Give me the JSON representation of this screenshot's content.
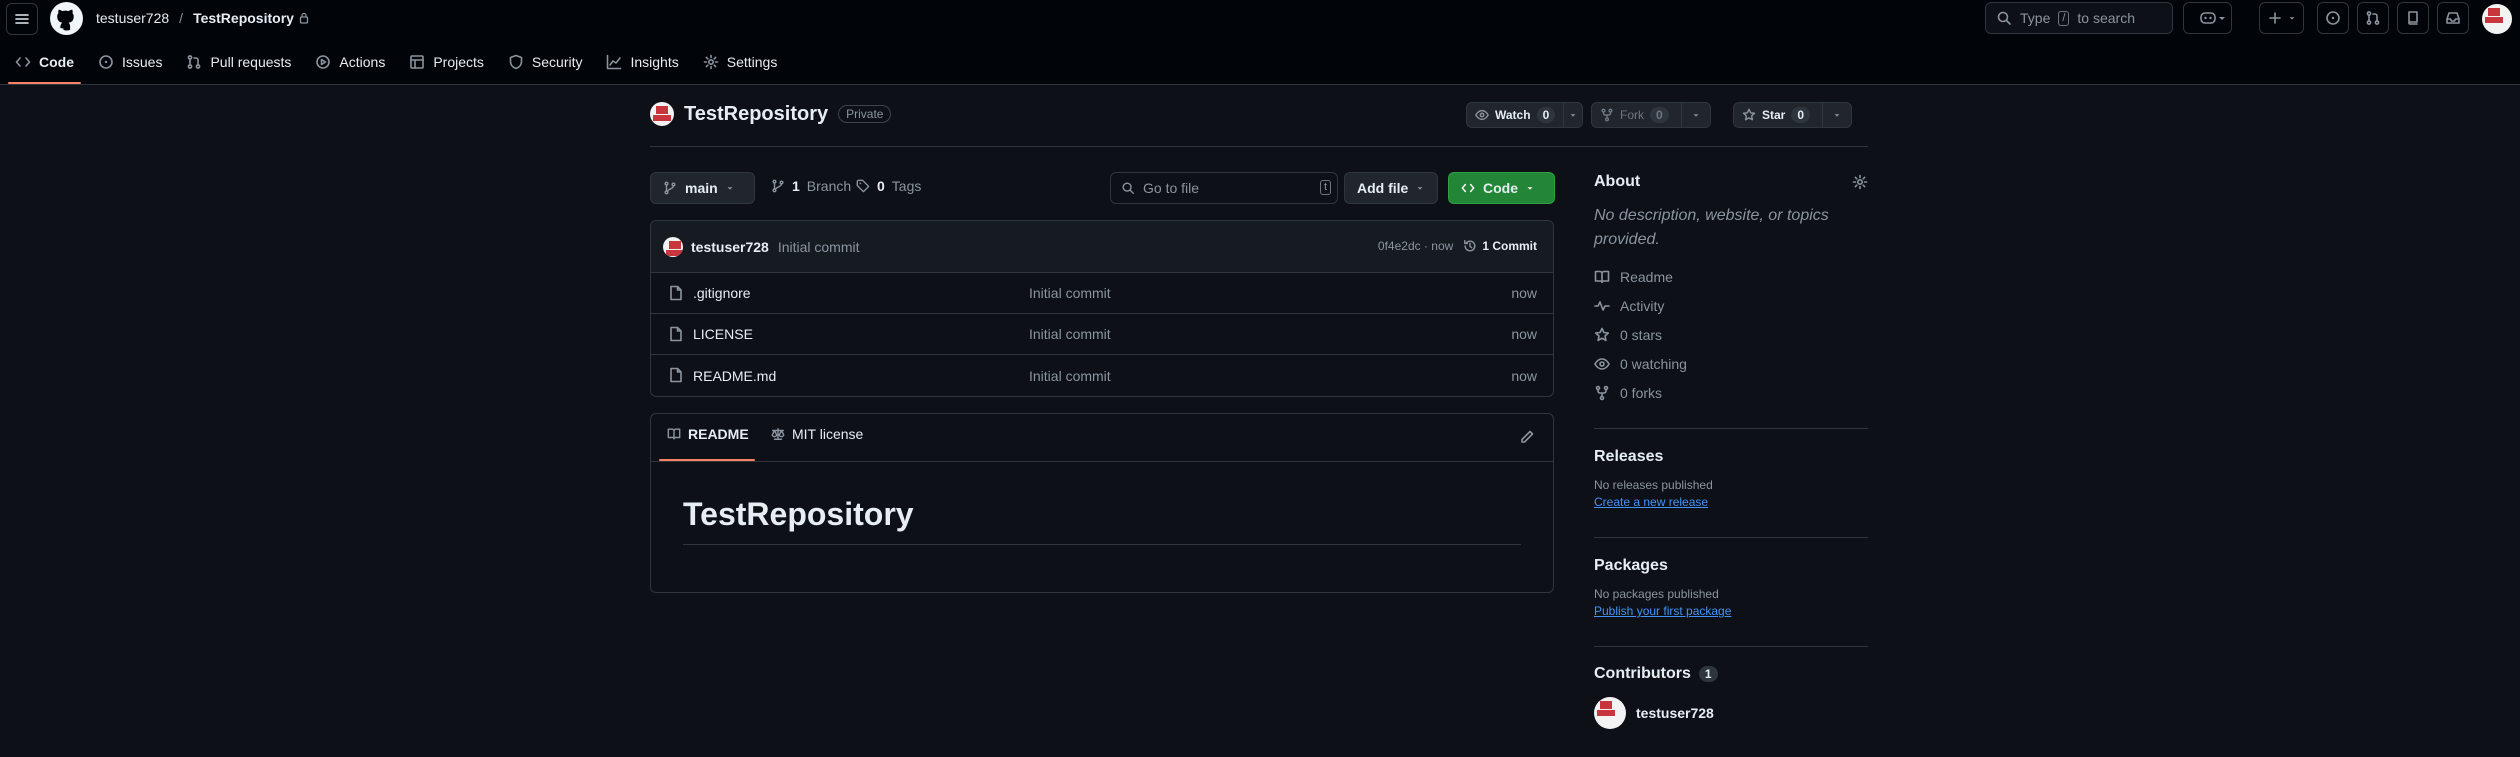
{
  "header": {
    "owner": "testuser728",
    "separator": "/",
    "repo": "TestRepository",
    "search_placeholder_1": "Type",
    "search_key": "/",
    "search_placeholder_2": "to search"
  },
  "tabs": [
    {
      "label": "Code",
      "icon": "code-icon"
    },
    {
      "label": "Issues",
      "icon": "issue-icon"
    },
    {
      "label": "Pull requests",
      "icon": "pull-request-icon"
    },
    {
      "label": "Actions",
      "icon": "play-icon"
    },
    {
      "label": "Projects",
      "icon": "table-icon"
    },
    {
      "label": "Security",
      "icon": "shield-icon"
    },
    {
      "label": "Insights",
      "icon": "graph-icon"
    },
    {
      "label": "Settings",
      "icon": "gear-icon"
    }
  ],
  "repo": {
    "name": "TestRepository",
    "visibility": "Private",
    "watch_label": "Watch",
    "watch_count": "0",
    "fork_label": "Fork",
    "fork_count": "0",
    "star_label": "Star",
    "star_count": "0"
  },
  "toolbar": {
    "branch": "main",
    "branch_count": "1",
    "branch_label": "Branch",
    "tag_count": "0",
    "tag_label": "Tags",
    "goto_placeholder": "Go to file",
    "goto_key": "t",
    "add_file": "Add file",
    "code": "Code"
  },
  "commit": {
    "author": "testuser728",
    "message": "Initial commit",
    "hash_time": "0f4e2dc · now",
    "count": "1 Commit"
  },
  "files": [
    {
      "name": ".gitignore",
      "message": "Initial commit",
      "time": "now"
    },
    {
      "name": "LICENSE",
      "message": "Initial commit",
      "time": "now"
    },
    {
      "name": "README.md",
      "message": "Initial commit",
      "time": "now"
    }
  ],
  "readme": {
    "tab_readme": "README",
    "tab_license": "MIT license",
    "heading": "TestRepository"
  },
  "sidebar": {
    "about_title": "About",
    "about_desc": "No description, website, or topics provided.",
    "items": [
      {
        "label": "Readme",
        "icon": "book-icon"
      },
      {
        "label": "Activity",
        "icon": "pulse-icon"
      },
      {
        "label": "0 stars",
        "icon": "star-icon"
      },
      {
        "label": "0 watching",
        "icon": "eye-icon"
      },
      {
        "label": "0 forks",
        "icon": "fork-icon"
      }
    ],
    "releases_title": "Releases",
    "releases_text": "No releases published",
    "releases_link": "Create a new release",
    "packages_title": "Packages",
    "packages_text": "No packages published",
    "packages_link": "Publish your first package",
    "contributors_title": "Contributors",
    "contributors_count": "1",
    "contributor_name": "testuser728"
  },
  "colors": {
    "background": "#0d1117",
    "accent_underline": "#f78166",
    "green_button": "#238636",
    "link": "#4493f8"
  }
}
